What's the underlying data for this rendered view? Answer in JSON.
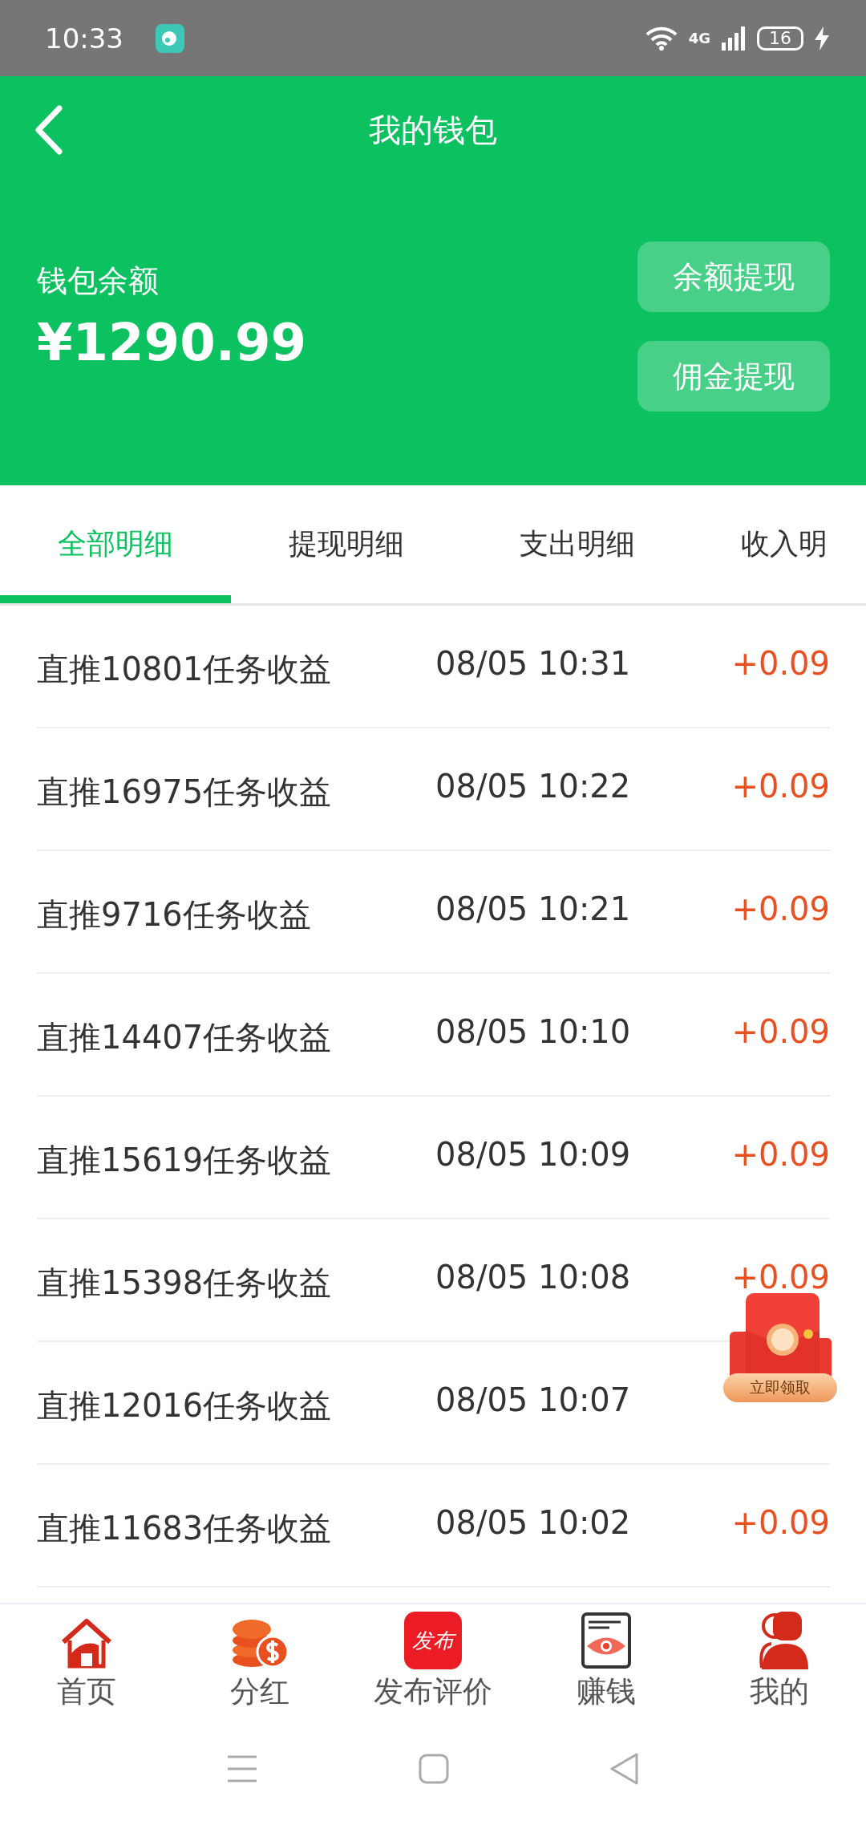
{
  "status_bar": {
    "time": "10:33",
    "network": "4G",
    "battery": "16"
  },
  "header": {
    "title": "我的钱包",
    "balance_label": "钱包余额",
    "balance": "¥1290.99",
    "buttons": [
      "余额提现",
      "佣金提现"
    ]
  },
  "tabs": [
    {
      "label": "全部明细",
      "selected": true
    },
    {
      "label": "提现明细",
      "selected": false
    },
    {
      "label": "支出明细",
      "selected": false
    },
    {
      "label": "收入明",
      "selected": false
    }
  ],
  "records": [
    {
      "title": "直推10801任务收益",
      "time": "08/05 10:31",
      "amount": "+0.09"
    },
    {
      "title": "直推16975任务收益",
      "time": "08/05 10:22",
      "amount": "+0.09"
    },
    {
      "title": "直推9716任务收益",
      "time": "08/05 10:21",
      "amount": "+0.09"
    },
    {
      "title": "直推14407任务收益",
      "time": "08/05 10:10",
      "amount": "+0.09"
    },
    {
      "title": "直推15619任务收益",
      "time": "08/05 10:09",
      "amount": "+0.09"
    },
    {
      "title": "直推15398任务收益",
      "time": "08/05 10:08",
      "amount": "+0.09"
    },
    {
      "title": "直推12016任务收益",
      "time": "08/05 10:07"
    },
    {
      "title": "直推11683任务收益",
      "time": "08/05 10:02",
      "amount": "+0.09"
    }
  ],
  "red_packet": {
    "label": "立即领取"
  },
  "bottom_nav": [
    {
      "kind": "home",
      "label": "首页"
    },
    {
      "kind": "coins",
      "label": "分红"
    },
    {
      "kind": "publish",
      "label": "发布评价",
      "badge": "发布"
    },
    {
      "kind": "earn",
      "label": "赚钱"
    },
    {
      "kind": "profile",
      "label": "我的"
    }
  ]
}
